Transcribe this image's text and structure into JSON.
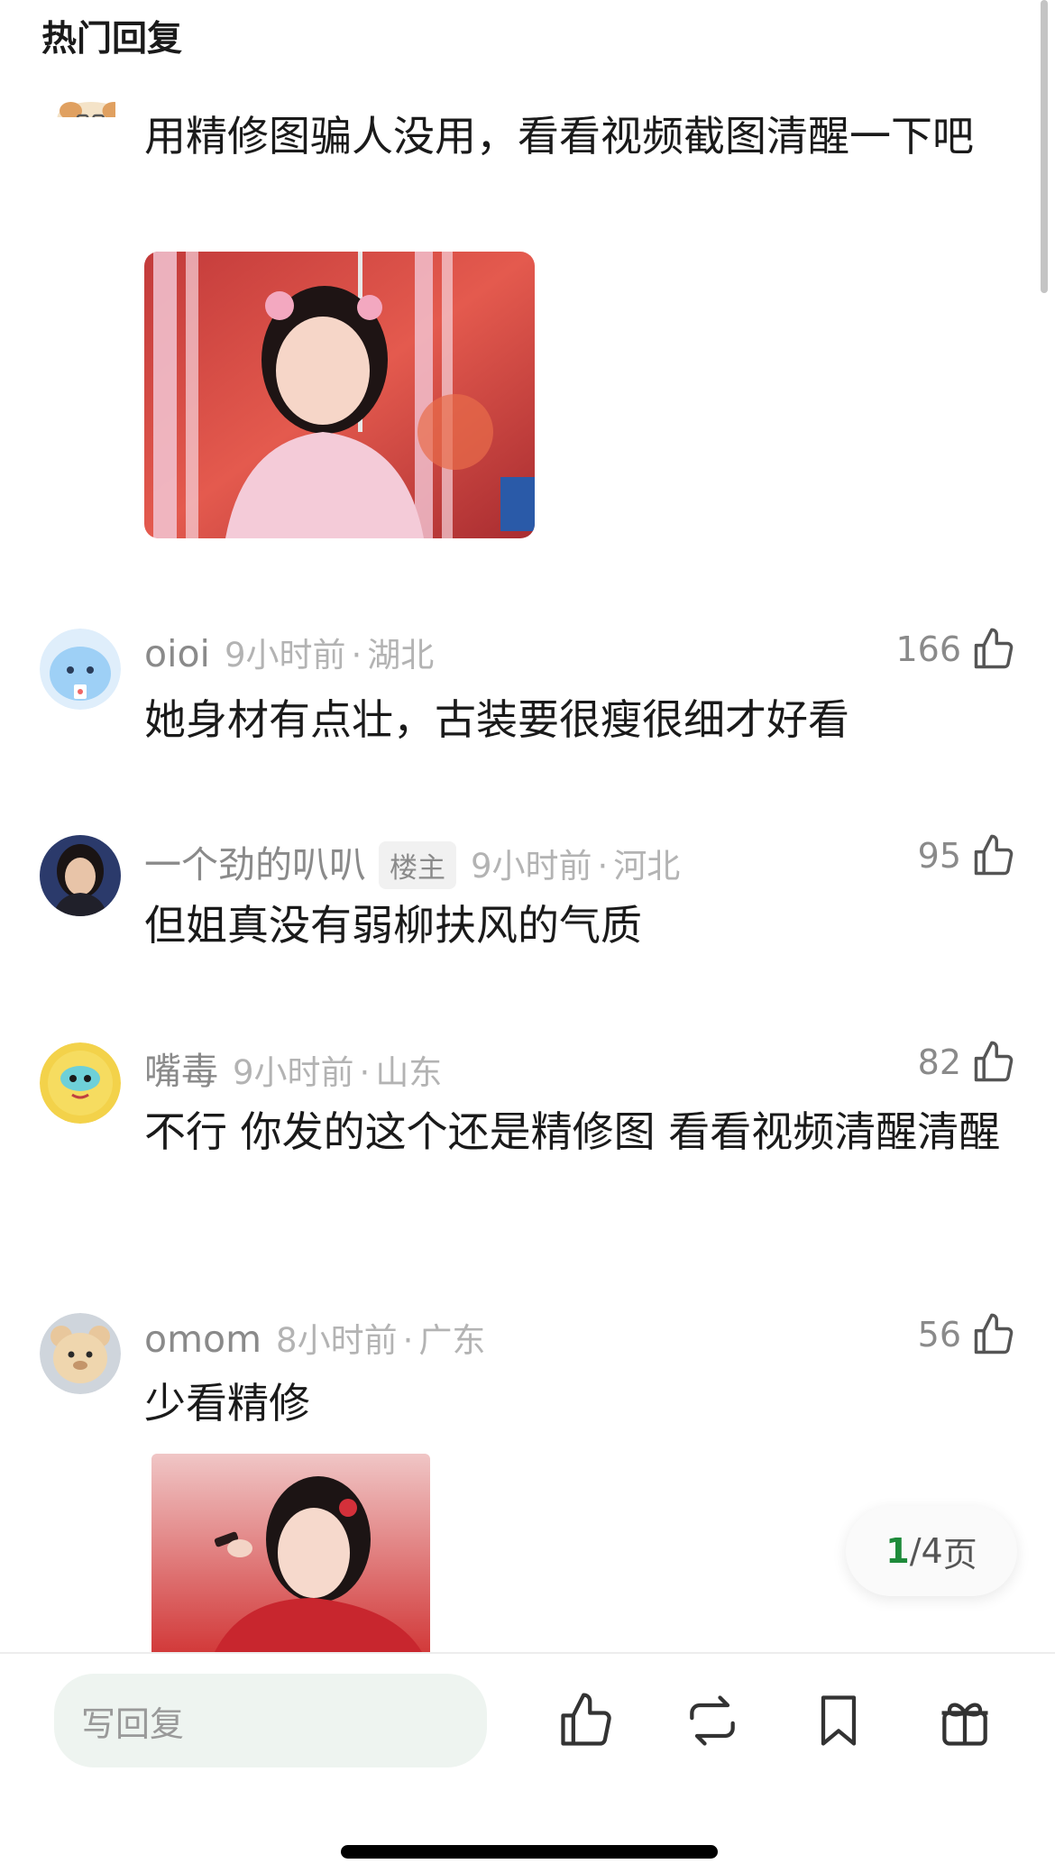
{
  "header": {
    "title": "热门回复"
  },
  "comments": [
    {
      "text": "用精修图骗人没用，看看视频截图清醒一下吧"
    },
    {
      "username": "oioi",
      "time": "9小时前",
      "location": "湖北",
      "likes": "166",
      "text": "她身材有点壮，古装要很瘦很细才好看"
    },
    {
      "username": "一个劲的叭叭",
      "badge": "楼主",
      "time": "9小时前",
      "location": "河北",
      "likes": "95",
      "text": "但姐真没有弱柳扶风的气质"
    },
    {
      "username": "嘴毒",
      "time": "9小时前",
      "location": "山东",
      "likes": "82",
      "text": "不行 你发的这个还是精修图 看看视频清醒清醒"
    },
    {
      "username": "omom",
      "time": "8小时前",
      "location": "广东",
      "likes": "56",
      "text": "少看精修"
    }
  ],
  "pagination": {
    "current": "1",
    "total": "/4",
    "unit": " 页"
  },
  "bottom_bar": {
    "reply_placeholder": "写回复"
  },
  "icons": {
    "like": "thumbs-up-icon",
    "repost": "repost-icon",
    "bookmark": "bookmark-icon",
    "gift": "gift-icon"
  },
  "colors": {
    "accent_green": "#1e8a3a",
    "muted_text": "#8a8a8a",
    "input_bg": "#eef4f0"
  }
}
